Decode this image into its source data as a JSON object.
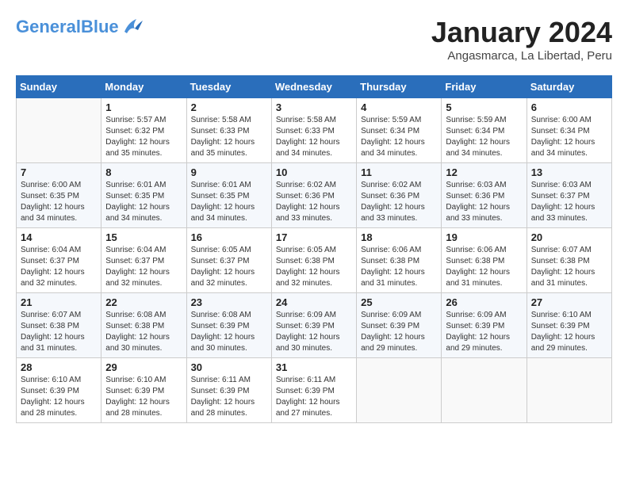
{
  "header": {
    "logo_line1": "General",
    "logo_line2": "Blue",
    "month_title": "January 2024",
    "subtitle": "Angasmarca, La Libertad, Peru"
  },
  "days_of_week": [
    "Sunday",
    "Monday",
    "Tuesday",
    "Wednesday",
    "Thursday",
    "Friday",
    "Saturday"
  ],
  "weeks": [
    [
      {
        "day": "",
        "info": ""
      },
      {
        "day": "1",
        "info": "Sunrise: 5:57 AM\nSunset: 6:32 PM\nDaylight: 12 hours\nand 35 minutes."
      },
      {
        "day": "2",
        "info": "Sunrise: 5:58 AM\nSunset: 6:33 PM\nDaylight: 12 hours\nand 35 minutes."
      },
      {
        "day": "3",
        "info": "Sunrise: 5:58 AM\nSunset: 6:33 PM\nDaylight: 12 hours\nand 34 minutes."
      },
      {
        "day": "4",
        "info": "Sunrise: 5:59 AM\nSunset: 6:34 PM\nDaylight: 12 hours\nand 34 minutes."
      },
      {
        "day": "5",
        "info": "Sunrise: 5:59 AM\nSunset: 6:34 PM\nDaylight: 12 hours\nand 34 minutes."
      },
      {
        "day": "6",
        "info": "Sunrise: 6:00 AM\nSunset: 6:34 PM\nDaylight: 12 hours\nand 34 minutes."
      }
    ],
    [
      {
        "day": "7",
        "info": "Sunrise: 6:00 AM\nSunset: 6:35 PM\nDaylight: 12 hours\nand 34 minutes."
      },
      {
        "day": "8",
        "info": "Sunrise: 6:01 AM\nSunset: 6:35 PM\nDaylight: 12 hours\nand 34 minutes."
      },
      {
        "day": "9",
        "info": "Sunrise: 6:01 AM\nSunset: 6:35 PM\nDaylight: 12 hours\nand 34 minutes."
      },
      {
        "day": "10",
        "info": "Sunrise: 6:02 AM\nSunset: 6:36 PM\nDaylight: 12 hours\nand 33 minutes."
      },
      {
        "day": "11",
        "info": "Sunrise: 6:02 AM\nSunset: 6:36 PM\nDaylight: 12 hours\nand 33 minutes."
      },
      {
        "day": "12",
        "info": "Sunrise: 6:03 AM\nSunset: 6:36 PM\nDaylight: 12 hours\nand 33 minutes."
      },
      {
        "day": "13",
        "info": "Sunrise: 6:03 AM\nSunset: 6:37 PM\nDaylight: 12 hours\nand 33 minutes."
      }
    ],
    [
      {
        "day": "14",
        "info": "Sunrise: 6:04 AM\nSunset: 6:37 PM\nDaylight: 12 hours\nand 32 minutes."
      },
      {
        "day": "15",
        "info": "Sunrise: 6:04 AM\nSunset: 6:37 PM\nDaylight: 12 hours\nand 32 minutes."
      },
      {
        "day": "16",
        "info": "Sunrise: 6:05 AM\nSunset: 6:37 PM\nDaylight: 12 hours\nand 32 minutes."
      },
      {
        "day": "17",
        "info": "Sunrise: 6:05 AM\nSunset: 6:38 PM\nDaylight: 12 hours\nand 32 minutes."
      },
      {
        "day": "18",
        "info": "Sunrise: 6:06 AM\nSunset: 6:38 PM\nDaylight: 12 hours\nand 31 minutes."
      },
      {
        "day": "19",
        "info": "Sunrise: 6:06 AM\nSunset: 6:38 PM\nDaylight: 12 hours\nand 31 minutes."
      },
      {
        "day": "20",
        "info": "Sunrise: 6:07 AM\nSunset: 6:38 PM\nDaylight: 12 hours\nand 31 minutes."
      }
    ],
    [
      {
        "day": "21",
        "info": "Sunrise: 6:07 AM\nSunset: 6:38 PM\nDaylight: 12 hours\nand 31 minutes."
      },
      {
        "day": "22",
        "info": "Sunrise: 6:08 AM\nSunset: 6:38 PM\nDaylight: 12 hours\nand 30 minutes."
      },
      {
        "day": "23",
        "info": "Sunrise: 6:08 AM\nSunset: 6:39 PM\nDaylight: 12 hours\nand 30 minutes."
      },
      {
        "day": "24",
        "info": "Sunrise: 6:09 AM\nSunset: 6:39 PM\nDaylight: 12 hours\nand 30 minutes."
      },
      {
        "day": "25",
        "info": "Sunrise: 6:09 AM\nSunset: 6:39 PM\nDaylight: 12 hours\nand 29 minutes."
      },
      {
        "day": "26",
        "info": "Sunrise: 6:09 AM\nSunset: 6:39 PM\nDaylight: 12 hours\nand 29 minutes."
      },
      {
        "day": "27",
        "info": "Sunrise: 6:10 AM\nSunset: 6:39 PM\nDaylight: 12 hours\nand 29 minutes."
      }
    ],
    [
      {
        "day": "28",
        "info": "Sunrise: 6:10 AM\nSunset: 6:39 PM\nDaylight: 12 hours\nand 28 minutes."
      },
      {
        "day": "29",
        "info": "Sunrise: 6:10 AM\nSunset: 6:39 PM\nDaylight: 12 hours\nand 28 minutes."
      },
      {
        "day": "30",
        "info": "Sunrise: 6:11 AM\nSunset: 6:39 PM\nDaylight: 12 hours\nand 28 minutes."
      },
      {
        "day": "31",
        "info": "Sunrise: 6:11 AM\nSunset: 6:39 PM\nDaylight: 12 hours\nand 27 minutes."
      },
      {
        "day": "",
        "info": ""
      },
      {
        "day": "",
        "info": ""
      },
      {
        "day": "",
        "info": ""
      }
    ]
  ]
}
